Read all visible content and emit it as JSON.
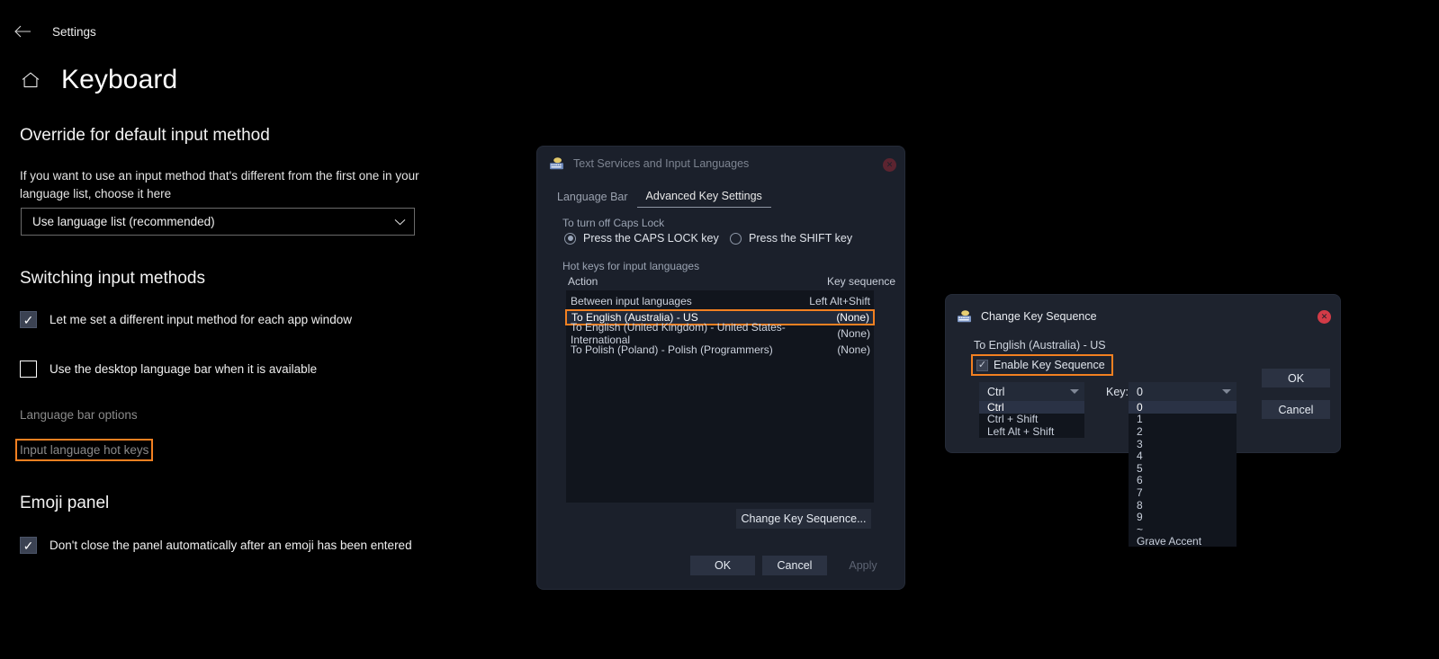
{
  "settings": {
    "nav": {
      "back_icon": "back-arrow-icon",
      "title": "Settings"
    },
    "home_icon": "home-icon",
    "page_title": "Keyboard",
    "sections": [
      {
        "heading": "Override for default input method",
        "description": "If you want to use an input method that's different from the first one in your language list, choose it here",
        "dropdown_value": "Use language list (recommended)",
        "dropdown_icon": "chevron-down-icon"
      },
      {
        "heading": "Switching input methods",
        "checkboxes": [
          {
            "label": "Let me set a different input method for each app window",
            "checked": true
          },
          {
            "label": "Use the desktop language bar when it is available",
            "checked": false
          }
        ],
        "links": [
          {
            "label": "Language bar options",
            "highlighted": false
          },
          {
            "label": "Input language hot keys",
            "highlighted": true
          }
        ]
      },
      {
        "heading": "Emoji panel",
        "checkboxes": [
          {
            "label": "Don't close the panel automatically after an emoji has been entered",
            "checked": true
          }
        ]
      }
    ]
  },
  "text_services_dialog": {
    "title": "Text Services and Input Languages",
    "title_icon": "keyboard-icon",
    "close_icon": "close-icon",
    "tabs": [
      {
        "label": "Language Bar",
        "active": false
      },
      {
        "label": "Advanced Key Settings",
        "active": true
      }
    ],
    "caps_lock": {
      "group_label": "To turn off Caps Lock",
      "options": [
        {
          "label": "Press the CAPS LOCK key",
          "selected": true
        },
        {
          "label": "Press the SHIFT key",
          "selected": false
        }
      ]
    },
    "hotkeys": {
      "group_label": "Hot keys for input languages",
      "columns": [
        "Action",
        "Key sequence"
      ],
      "rows": [
        {
          "action": "Between input languages",
          "key_sequence": "Left Alt+Shift",
          "selected": false
        },
        {
          "action": "To English (Australia) - US",
          "key_sequence": "(None)",
          "selected": true
        },
        {
          "action": "To English (United Kingdom) - United States-International",
          "key_sequence": "(None)",
          "selected": false
        },
        {
          "action": "To Polish (Poland) - Polish (Programmers)",
          "key_sequence": "(None)",
          "selected": false
        }
      ]
    },
    "change_button": "Change Key Sequence...",
    "footer_buttons": [
      {
        "label": "OK",
        "enabled": true
      },
      {
        "label": "Cancel",
        "enabled": true
      },
      {
        "label": "Apply",
        "enabled": false
      }
    ]
  },
  "change_key_sequence_dialog": {
    "title": "Change Key Sequence",
    "title_icon": "keyboard-icon",
    "close_icon": "close-icon",
    "subtitle": "To English (Australia) - US",
    "enable_checkbox": {
      "label": "Enable Key Sequence",
      "checked": true
    },
    "modifier_dropdown": {
      "value": "Ctrl",
      "arrow_icon": "chevron-down-icon",
      "options": [
        "Ctrl",
        "Ctrl + Shift",
        "Left Alt + Shift"
      ],
      "selected_index": 0
    },
    "key_label": "Key:",
    "key_dropdown": {
      "value": "0",
      "arrow_icon": "chevron-down-icon",
      "options": [
        "0",
        "1",
        "2",
        "3",
        "4",
        "5",
        "6",
        "7",
        "8",
        "9",
        "~",
        "Grave Accent"
      ],
      "selected_index": 0
    },
    "buttons": [
      {
        "label": "OK"
      },
      {
        "label": "Cancel"
      }
    ]
  },
  "colors": {
    "accent_highlight": "#f28021",
    "dialog_bg": "#1e232e",
    "list_bg": "#11151d",
    "close_active": "#d23b47",
    "close_inactive": "#5c2430"
  }
}
